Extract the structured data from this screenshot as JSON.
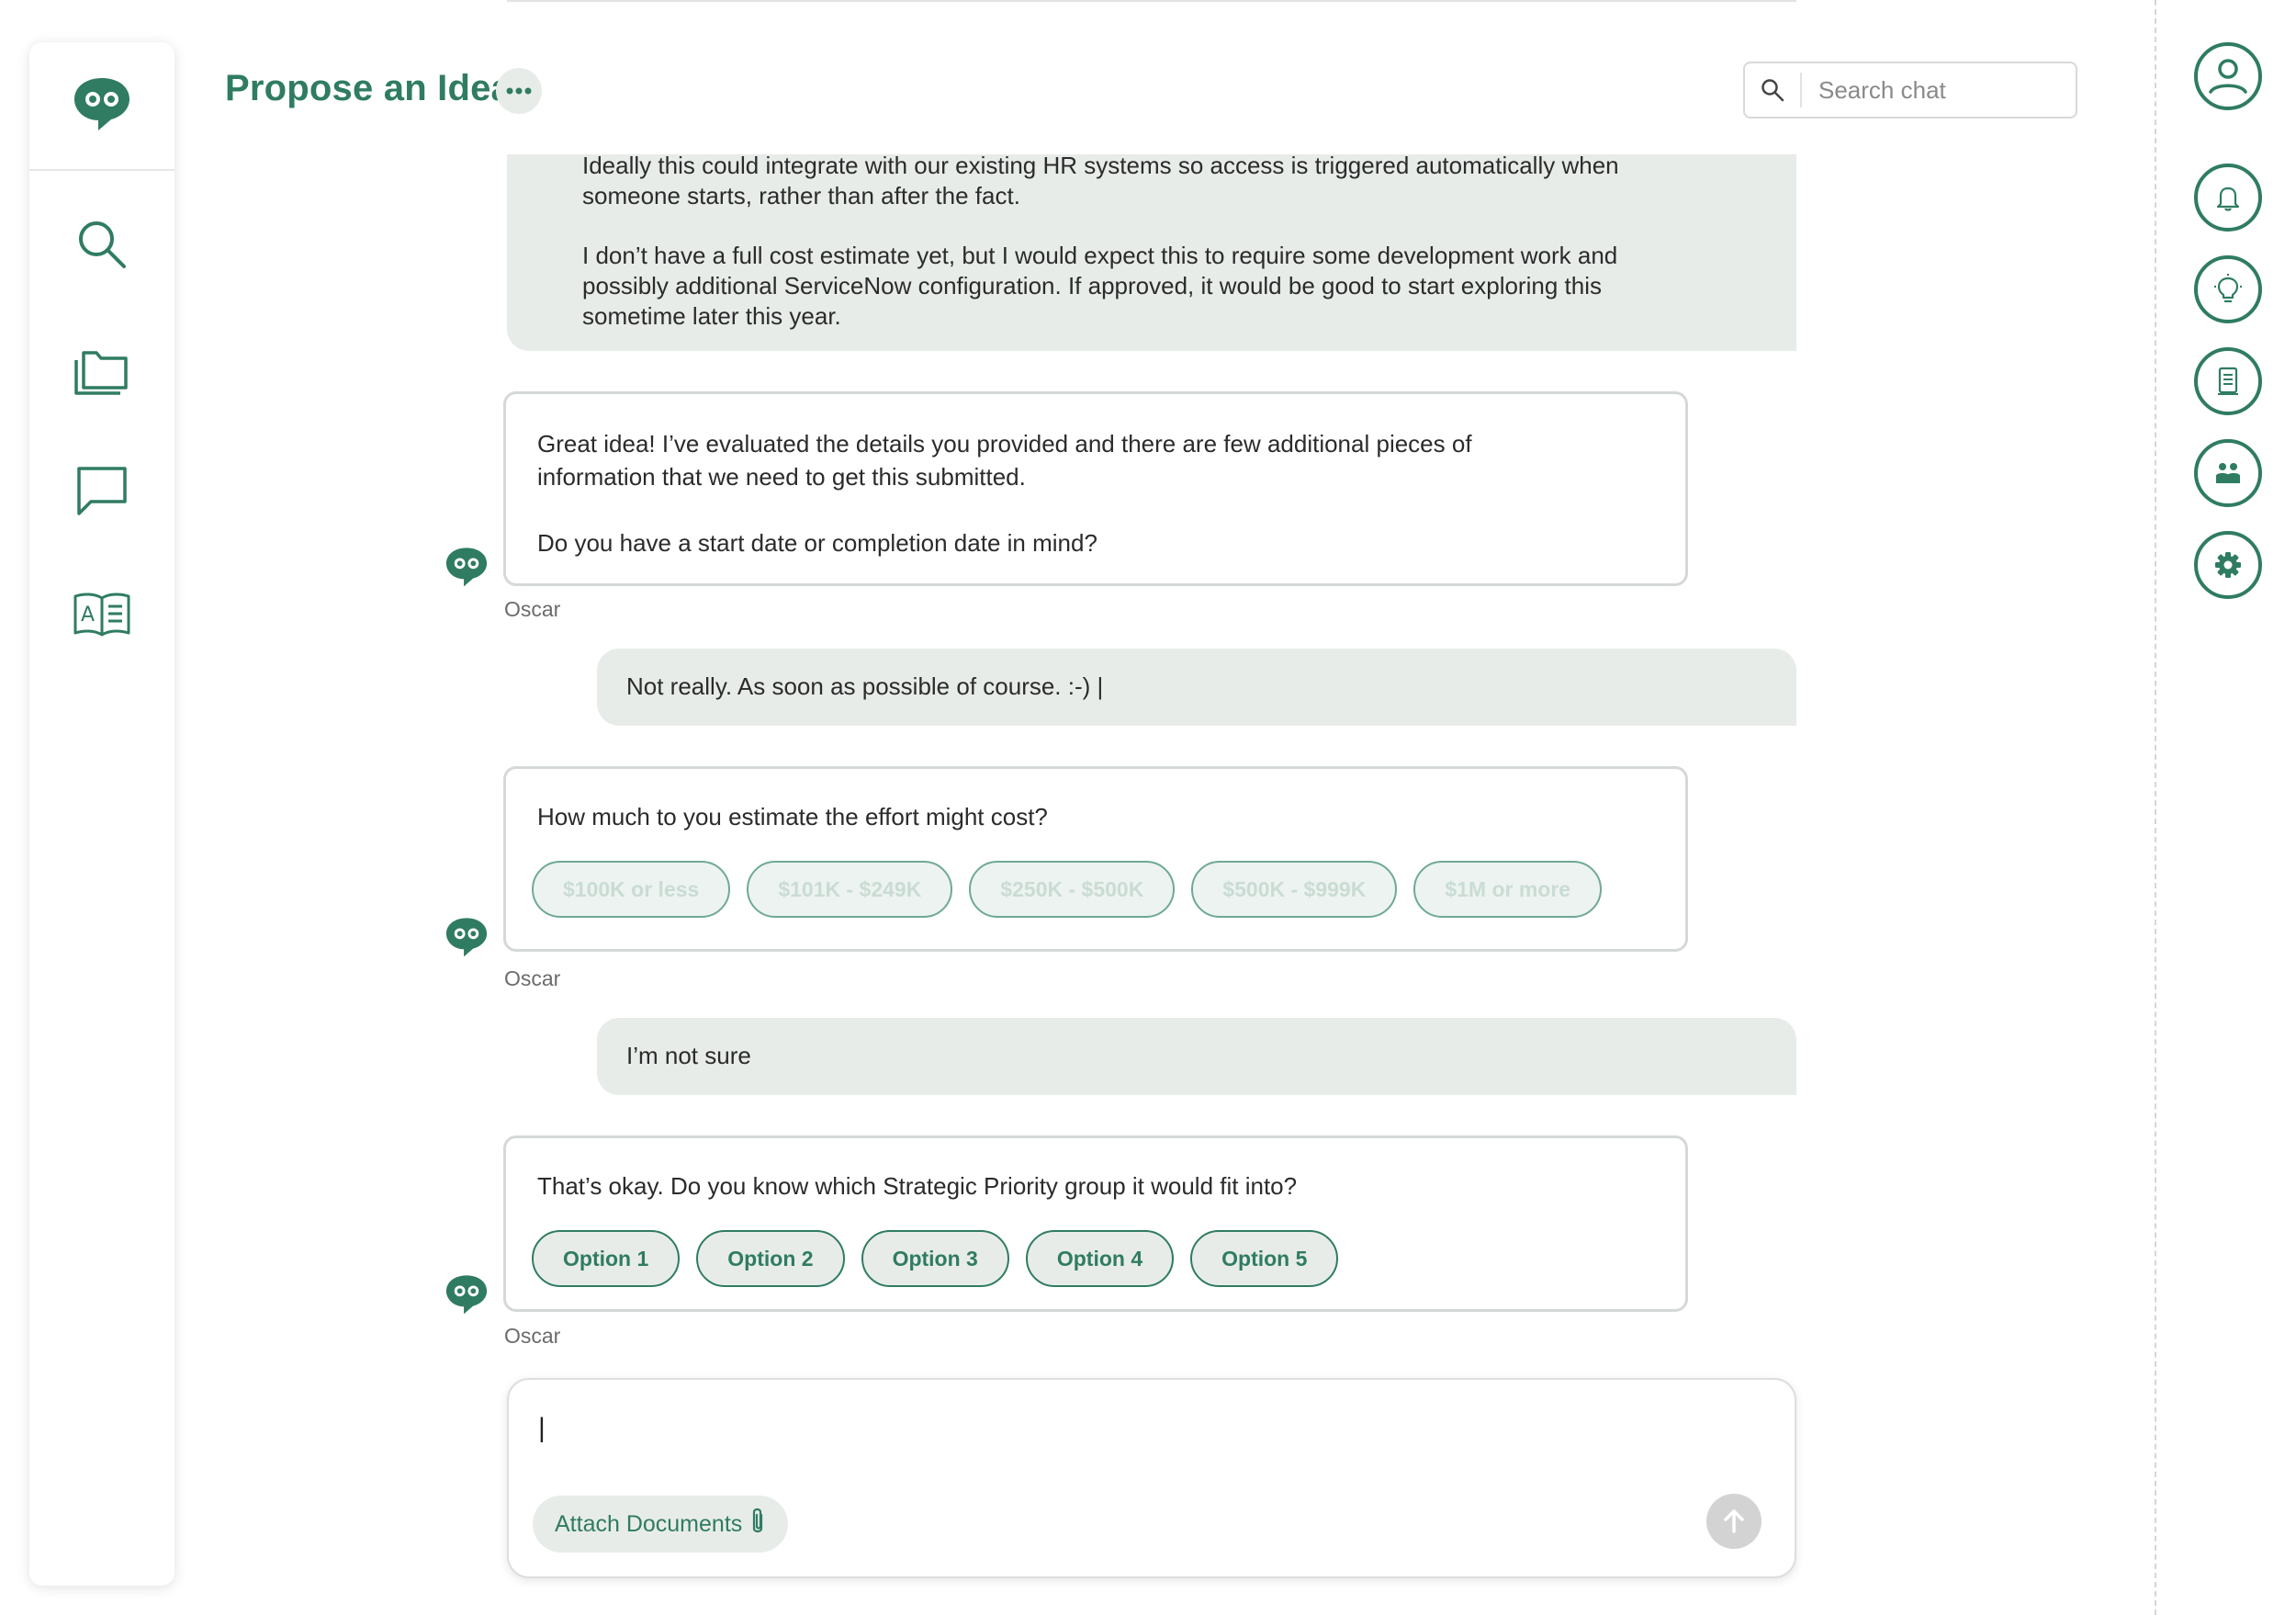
{
  "header": {
    "title": "Propose an Idea",
    "more_label": "more options",
    "search_placeholder": "Search chat"
  },
  "left_nav": [
    {
      "icon": "search-icon"
    },
    {
      "icon": "folder-icon"
    },
    {
      "icon": "chat-icon"
    },
    {
      "icon": "dictionary-icon"
    }
  ],
  "right_rail": [
    {
      "icon": "user-profile-icon"
    },
    {
      "icon": "bell-icon"
    },
    {
      "icon": "lightbulb-icon"
    },
    {
      "icon": "document-icon"
    },
    {
      "icon": "people-icon"
    },
    {
      "icon": "settings-gear-icon"
    }
  ],
  "messages": {
    "user_top": {
      "line1": "Ideally this could integrate with our existing HR systems so access is triggered automatically when",
      "line2": "someone starts, rather than after the fact.",
      "line3": "I don’t have a full cost estimate yet, but I would expect this to require some development work and",
      "line4": "possibly additional ServiceNow configuration. If approved, it would be good to start exploring this",
      "line5": "sometime later this year."
    },
    "bot_1": {
      "line1": "Great idea! I’ve evaluated the details you provided and there are few additional pieces of",
      "line2": "information that we need to get this submitted.",
      "line3": "Do you have a start date or completion date in mind?",
      "sender": "Oscar"
    },
    "user_2": "Not really. As soon as possible of course. :-) |",
    "bot_2": {
      "text": "How much to you estimate the effort might cost?",
      "options": [
        "$100K or less",
        "$101K - $249K",
        "$250K -  $500K",
        "$500K - $999K",
        "$1M or more"
      ],
      "sender": "Oscar"
    },
    "user_3": "I’m not sure",
    "bot_3": {
      "text": "That’s okay. Do you know which Strategic Priority group it would fit into?",
      "options": [
        "Option 1",
        "Option 2",
        "Option 3",
        "Option 4",
        "Option 5"
      ],
      "sender": "Oscar"
    }
  },
  "composer": {
    "value": "|",
    "attach_label": "Attach Documents"
  },
  "colors": {
    "brand_green": "#2f7c62",
    "bubble_gray": "#e8ece9",
    "card_border": "#d5d9d6"
  }
}
